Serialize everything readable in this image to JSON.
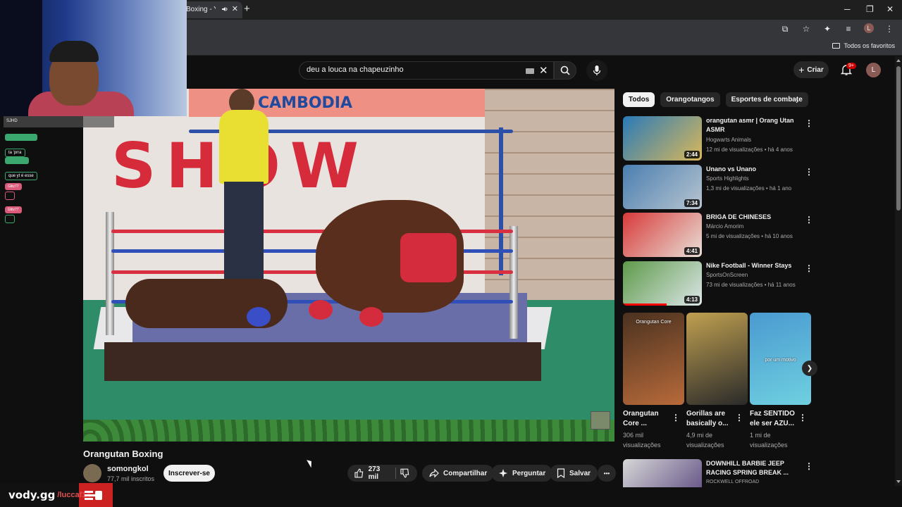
{
  "browser": {
    "tab_title": "Boxing - Yo",
    "new_tab": "+",
    "win_min": "─",
    "win_max": "❐",
    "win_close": "✕",
    "profile_initial": "L",
    "bookmarks_label": "Todos os favoritos"
  },
  "header": {
    "search_query": "deu a louca na chapeuzinho",
    "create_label": "Criar",
    "notif_count": "9+",
    "avatar_initial": "L"
  },
  "overlay": {
    "chat": [
      {
        "top": "SJHD"
      },
      {
        "tag": "",
        "msg": "ta 'prra"
      },
      {
        "tag": "",
        "msg": "que yt é esse"
      },
      {
        "tag": "Glitz77",
        "msg": ""
      },
      {
        "tag": "Glitz77",
        "msg": ""
      }
    ],
    "watermark_logo": "vody.gg",
    "watermark_user": "/luccaf14"
  },
  "video": {
    "banner_text": "CAMBODIA",
    "sign_text": "SHOW",
    "title": "Orangutan Boxing",
    "channel": "somongkol",
    "subscribers": "77,7 mil inscritos",
    "subscribe_label": "Inscrever-se",
    "likes": "273 mil",
    "share_label": "Compartilhar",
    "ask_label": "Perguntar",
    "save_label": "Salvar",
    "more_label": "•••"
  },
  "sidebar": {
    "chips": [
      "Todos",
      "Orangotangos",
      "Esportes de combate"
    ],
    "recommendations": [
      {
        "title": "orangutan asmr | Orang Utan ASMR",
        "channel": "Hogwarts Animals",
        "meta": "12 mi de visualizações • há 4 anos",
        "duration": "2:44",
        "colors": [
          "#2a7ab8",
          "#d9b85a"
        ]
      },
      {
        "title": "Unano vs Unano",
        "channel": "Sports Highlights",
        "meta": "1,3 mi de visualizações • há 1 ano",
        "duration": "7:34",
        "colors": [
          "#4a7fb0",
          "#b8c4d0"
        ]
      },
      {
        "title": "BRIGA DE CHINESES",
        "channel": "Márcio Amorim",
        "meta": "5 mi de visualizações • há 10 anos",
        "duration": "4:41",
        "colors": [
          "#d83a3a",
          "#e8e0d8"
        ]
      },
      {
        "title": "Nike Football - Winner Stays",
        "channel": "SportsOnScreen",
        "meta": "73 mi de visualizações • há 11 anos",
        "duration": "4:13",
        "colors": [
          "#5e9a4a",
          "#dce6e8"
        ],
        "progress": 0.55
      }
    ],
    "shorts": [
      {
        "title": "Orangutan Core ...",
        "views": "306 mil visualizações",
        "overlay": "Orangutan Core",
        "colors": [
          "#4a3220",
          "#b86a3a"
        ]
      },
      {
        "title": "Gorillas are basically o...",
        "views": "4,9 mi de visualizações",
        "overlay": "",
        "colors": [
          "#c0a050",
          "#2a2a2a"
        ]
      },
      {
        "title": "Faz SENTIDO ele ser AZU...",
        "views": "1 mi de visualizações",
        "overlay": "por um motivo",
        "colors": [
          "#4a9ad0",
          "#6fd0e0"
        ]
      }
    ],
    "bottom_rec": {
      "title": "DOWNHILL BARBIE JEEP RACING SPRING BREAK ...",
      "channel": "ROCKWELL OFFROAD"
    }
  }
}
